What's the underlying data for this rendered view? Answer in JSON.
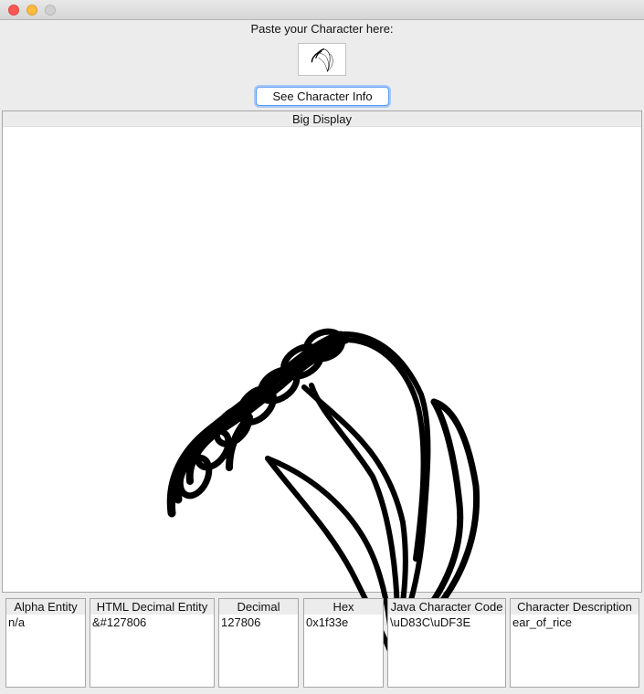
{
  "window": {
    "buttons": [
      "close",
      "minimize",
      "maximize"
    ]
  },
  "input": {
    "label": "Paste your Character here:",
    "value_icon": "ear-of-rice-icon"
  },
  "actions": {
    "info_button": "See Character Info"
  },
  "display": {
    "title": "Big Display",
    "glyph_icon": "ear-of-rice-icon"
  },
  "info": [
    {
      "title": "Alpha Entity",
      "value": "n/a"
    },
    {
      "title": "HTML Decimal Entity",
      "value": "&#127806"
    },
    {
      "title": "Decimal",
      "value": "127806"
    },
    {
      "title": "Hex",
      "value": "0x1f33e"
    },
    {
      "title": "Java Character Code",
      "value": "\\uD83C\\uDF3E"
    },
    {
      "title": "Character Description",
      "value": "ear_of_rice"
    }
  ],
  "colors": {
    "close": "#fc5753",
    "minimize": "#fdbc40",
    "maximize": "#d0d0d0",
    "focus": "#5b9bf1"
  }
}
